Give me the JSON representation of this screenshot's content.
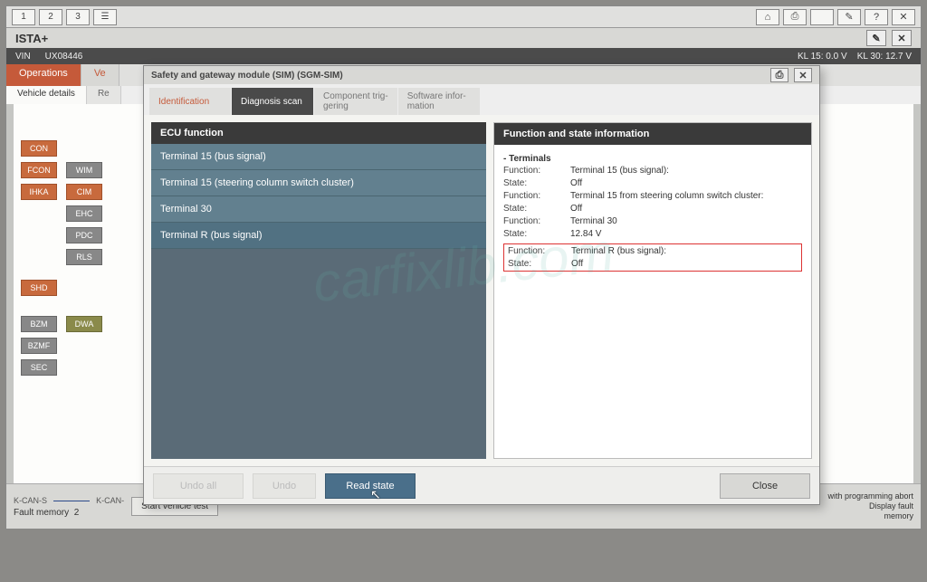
{
  "toolbar": {
    "pages": [
      "1",
      "2",
      "3"
    ]
  },
  "app_title": "ISTA+",
  "vin": {
    "label": "VIN",
    "value": "UX08446"
  },
  "kl15": {
    "label": "KL 15:",
    "value": "0.0 V"
  },
  "kl30": {
    "label": "KL 30:",
    "value": "12.7 V"
  },
  "main_tabs": {
    "operations": "Operations",
    "v2": "Ve"
  },
  "sub_tabs": {
    "vehicle_details": "Vehicle details",
    "r2": "Re"
  },
  "bg_ecus_col1": [
    "CON",
    "FCON",
    "IHKA",
    "EHC",
    "PDC",
    "RLS",
    "SHD",
    "BZM",
    "BZMF",
    "SEC"
  ],
  "bg_ecus_col2": {
    "wim": "WIM",
    "cim": "CIM",
    "dwa": "DWA"
  },
  "bottom": {
    "kcan_s": "K-CAN-S",
    "kcan": "K-CAN-",
    "fault_memory_label": "Fault memory",
    "fault_memory_value": "2",
    "start_btn": "Start vehicle test",
    "right_line1": "with programming abort",
    "right_line2": "Display fault",
    "right_line3": "memory"
  },
  "dialog": {
    "title": "Safety and gateway module (SIM) (SGM-SIM)",
    "tabs": {
      "identification": "Identification",
      "diagnosis": "Diagnosis scan",
      "trigger": "Component trig-\ngering",
      "software": "Software infor-\nmation"
    },
    "left_header": "ECU function",
    "left_items": [
      "Terminal 15 (bus signal)",
      "Terminal 15 (steering column switch cluster)",
      "Terminal 30",
      "Terminal R (bus signal)"
    ],
    "right_header": "Function and state information",
    "right_sub": "- Terminals",
    "rows": [
      {
        "function": "Terminal 15 (bus signal):",
        "state": "Off"
      },
      {
        "function": "Terminal 15 from steering column switch cluster:",
        "state": "Off"
      },
      {
        "function": "Terminal 30",
        "state": "12.84 V"
      }
    ],
    "highlight": {
      "function": "Terminal R (bus signal):",
      "state": "Off"
    },
    "labels": {
      "function": "Function:",
      "state": "State:"
    },
    "footer": {
      "undo_all": "Undo all",
      "undo": "Undo",
      "read_state": "Read state",
      "close": "Close"
    }
  },
  "watermark": "carfixlib.com"
}
